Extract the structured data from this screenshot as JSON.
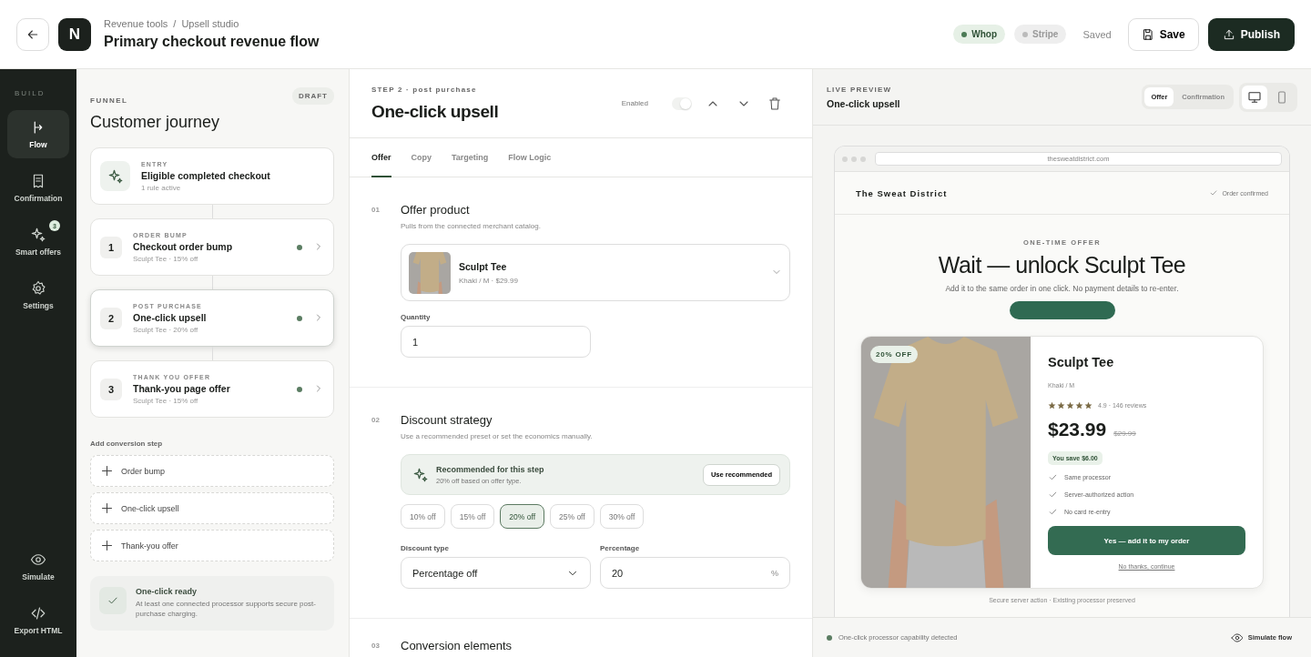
{
  "header": {
    "logo": "N",
    "breadcrumb": [
      "Revenue tools",
      "Upsell studio"
    ],
    "breadcrumb_separator": "/",
    "title": "Primary checkout revenue flow",
    "processors": [
      {
        "name": "Whop",
        "connected": true
      },
      {
        "name": "Stripe",
        "connected": false
      }
    ],
    "save_status": "Saved",
    "save_button": "Save",
    "publish_button": "Publish"
  },
  "sidebar": {
    "section": "BUILD",
    "items": [
      {
        "label": "Flow",
        "kind": "flow",
        "selected": true
      },
      {
        "label": "Confirmation",
        "kind": "confirmation",
        "selected": false
      },
      {
        "label": "Smart offers",
        "kind": "offers",
        "selected": false,
        "badge": "3"
      },
      {
        "label": "Settings",
        "kind": "settings",
        "selected": false
      }
    ],
    "bottom_items": [
      {
        "label": "Simulate",
        "kind": "simulate"
      },
      {
        "label": "Export HTML",
        "kind": "export"
      }
    ]
  },
  "funnel": {
    "label": "FUNNEL",
    "badge": "DRAFT",
    "title": "Customer journey",
    "entry": {
      "eyebrow": "ENTRY",
      "title": "Eligible completed checkout",
      "subtitle": "1 rule active"
    },
    "steps": [
      {
        "number": "1",
        "eyebrow": "ORDER BUMP",
        "title": "Checkout order bump",
        "subtitle": "Sculpt Tee · 15% off",
        "selected": false,
        "active": true
      },
      {
        "number": "2",
        "eyebrow": "POST PURCHASE",
        "title": "One-click upsell",
        "subtitle": "Sculpt Tee · 20% off",
        "selected": true,
        "active": true
      },
      {
        "number": "3",
        "eyebrow": "THANK YOU OFFER",
        "title": "Thank-you page offer",
        "subtitle": "Sculpt Tee · 15% off",
        "selected": false,
        "active": true
      }
    ],
    "add_title": "Add conversion step",
    "add_options": [
      "Order bump",
      "One-click upsell",
      "Thank-you offer"
    ],
    "ready": {
      "title": "One-click ready",
      "text": "At least one connected processor supports secure post-purchase charging."
    }
  },
  "editor": {
    "eyebrow": "STEP 2 · post purchase",
    "title": "One-click upsell",
    "toggle_label": "Enabled",
    "toggle_on": true,
    "tabs": [
      {
        "label": "Offer",
        "selected": true
      },
      {
        "label": "Copy",
        "selected": false
      },
      {
        "label": "Targeting",
        "selected": false
      },
      {
        "label": "Flow Logic",
        "selected": false
      }
    ],
    "offer_section": {
      "number": "01",
      "title": "Offer product",
      "subtitle": "Pulls from the connected merchant catalog.",
      "product_name": "Sculpt Tee",
      "product_meta": "Khaki / M · $29.99",
      "quantity_label": "Quantity",
      "quantity": "1"
    },
    "discount_section": {
      "number": "02",
      "title": "Discount strategy",
      "subtitle": "Use a recommended preset or set the economics manually.",
      "recommendation": {
        "title": "Recommended for this step",
        "text": "20% off based on offer type.",
        "button": "Use recommended"
      },
      "presets": [
        {
          "label": "10% off",
          "selected": false
        },
        {
          "label": "15% off",
          "selected": false
        },
        {
          "label": "20% off",
          "selected": true
        },
        {
          "label": "25% off",
          "selected": false
        },
        {
          "label": "30% off",
          "selected": false
        }
      ],
      "type_label": "Discount type",
      "type_value": "Percentage off",
      "percentage_label": "Percentage",
      "percentage_value": "20",
      "percentage_suffix": "%"
    },
    "next_section": {
      "number": "03",
      "title": "Conversion elements"
    }
  },
  "preview": {
    "label": "LIVE PREVIEW",
    "title": "One-click upsell",
    "modes": [
      {
        "label": "Offer",
        "selected": true
      },
      {
        "label": "Confirmation",
        "selected": false
      }
    ],
    "devices": [
      {
        "kind": "desktop",
        "selected": true
      },
      {
        "kind": "mobile",
        "selected": false
      }
    ],
    "url": "thesweatdistrict.com",
    "store_name": "The Sweat District",
    "order_status": "Order confirmed",
    "eyebrow": "ONE-TIME OFFER",
    "headline": "Wait — unlock Sculpt Tee",
    "subheadline": "Add it to the same order in one click. No payment details to re-enter.",
    "product": {
      "badge": "20% OFF",
      "name": "Sculpt Tee",
      "variant": "Khaki / M",
      "stars": 5,
      "rating": "4.9 · 146 reviews",
      "price": "$23.99",
      "old_price": "$29.99",
      "savings": "You save $6.00",
      "benefits": [
        "Same processor",
        "Server-authorized action",
        "No card re-entry"
      ],
      "accept_button": "Yes — add it to my order",
      "decline_link": "No thanks, continue"
    },
    "footnote": "Secure server action · Existing processor preserved",
    "status": "One-click processor capability detected",
    "simulate_button": "Simulate flow"
  }
}
